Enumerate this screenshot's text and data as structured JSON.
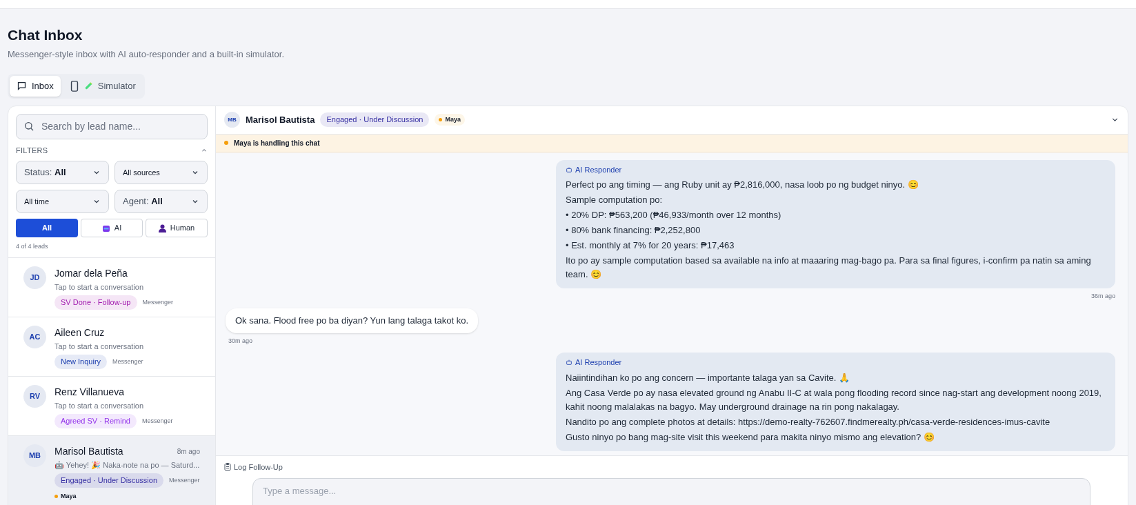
{
  "page": {
    "title": "Chat Inbox",
    "subtitle": "Messenger-style inbox with AI auto-responder and a built-in simulator."
  },
  "tabs": [
    {
      "label": "Inbox",
      "selected": true
    },
    {
      "label": "Simulator",
      "selected": false
    }
  ],
  "sidebar": {
    "search": {
      "placeholder": "Search by lead name..."
    },
    "filters": {
      "label": "FILTERS",
      "expanded": true,
      "selects": [
        {
          "label": "Status:",
          "value": "All"
        },
        {
          "value": "All sources"
        },
        {
          "value": "All time"
        },
        {
          "label": "Agent:",
          "value": "All"
        }
      ],
      "handler": [
        {
          "label": "All",
          "selected": true
        },
        {
          "label": "AI",
          "selected": false
        },
        {
          "label": "Human",
          "selected": false
        }
      ]
    },
    "count": "4 of 4 leads",
    "leads": [
      {
        "initials": "JD",
        "name": "Jomar dela Peña",
        "preview": "Tap to start a conversation",
        "status": {
          "label": "SV Done · Follow-up",
          "color": "#a21caf"
        },
        "source": "Messenger",
        "selected": false
      },
      {
        "initials": "AC",
        "name": "Aileen Cruz",
        "preview": "Tap to start a conversation",
        "status": {
          "label": "New Inquiry",
          "color": "#1e40af"
        },
        "source": "Messenger",
        "selected": false
      },
      {
        "initials": "RV",
        "name": "Renz Villanueva",
        "preview": "Tap to start a conversation",
        "status": {
          "label": "Agreed SV · Remind",
          "color": "#9333ea"
        },
        "source": "Messenger",
        "selected": false
      },
      {
        "initials": "MB",
        "name": "Marisol Bautista",
        "time": "8m ago",
        "preview": "🤖 Yehey! 🎉 Naka-note na po — Saturd...",
        "status": {
          "label": "Engaged · Under Discussion",
          "color": "#3730a3"
        },
        "source": "Messenger",
        "agent": {
          "name": "Maya",
          "color": "#f59e0b"
        },
        "selected": true
      }
    ]
  },
  "chat": {
    "initials": "MB",
    "name": "Marisol Bautista",
    "status": {
      "label": "Engaged · Under Discussion",
      "color": "#3730a3"
    },
    "agent": {
      "name": "Maya",
      "color": "#f59e0b"
    },
    "banner": {
      "text": "Maya is handling this chat",
      "color": "#f59e0b"
    },
    "messages": [
      {
        "kind": "ai",
        "sender": "AI Responder",
        "paragraphs": [
          "Perfect po ang timing — ang Ruby unit ay ₱2,816,000, nasa loob po ng budget ninyo. 😊",
          "Sample computation po:",
          "• 20% DP: ₱563,200 (₱46,933/month over 12 months)",
          "• 80% bank financing: ₱2,252,800",
          "• Est. monthly at 7% for 20 years: ₱17,463",
          "Ito po ay sample computation based sa available na info at maaaring mag-bago pa. Para sa final figures, i-confirm pa natin sa aming team. 😊"
        ],
        "time": "36m ago"
      },
      {
        "kind": "lead",
        "paragraphs": [
          "Ok sana. Flood free po ba diyan? Yun lang talaga takot ko."
        ],
        "time": "30m ago"
      },
      {
        "kind": "ai",
        "sender": "AI Responder",
        "paragraphs": [
          "Naiintindihan ko po ang concern — importante talaga yan sa Cavite. 🙏",
          "Ang Casa Verde po ay nasa elevated ground ng Anabu II-C at wala pong flooding record since nag-start ang development noong 2019, kahit noong malalakas na bagyo. May underground drainage na rin pong nakalagay.",
          "Nandito po ang complete photos at details: https://demo-realty-762607.findmerealty.ph/casa-verde-residences-imus-cavite",
          "Gusto ninyo po bang mag-site visit this weekend para makita ninyo mismo ang elevation? 😊"
        ]
      }
    ],
    "composer": {
      "action": "Log Follow-Up",
      "placeholder": "Type a message..."
    }
  }
}
